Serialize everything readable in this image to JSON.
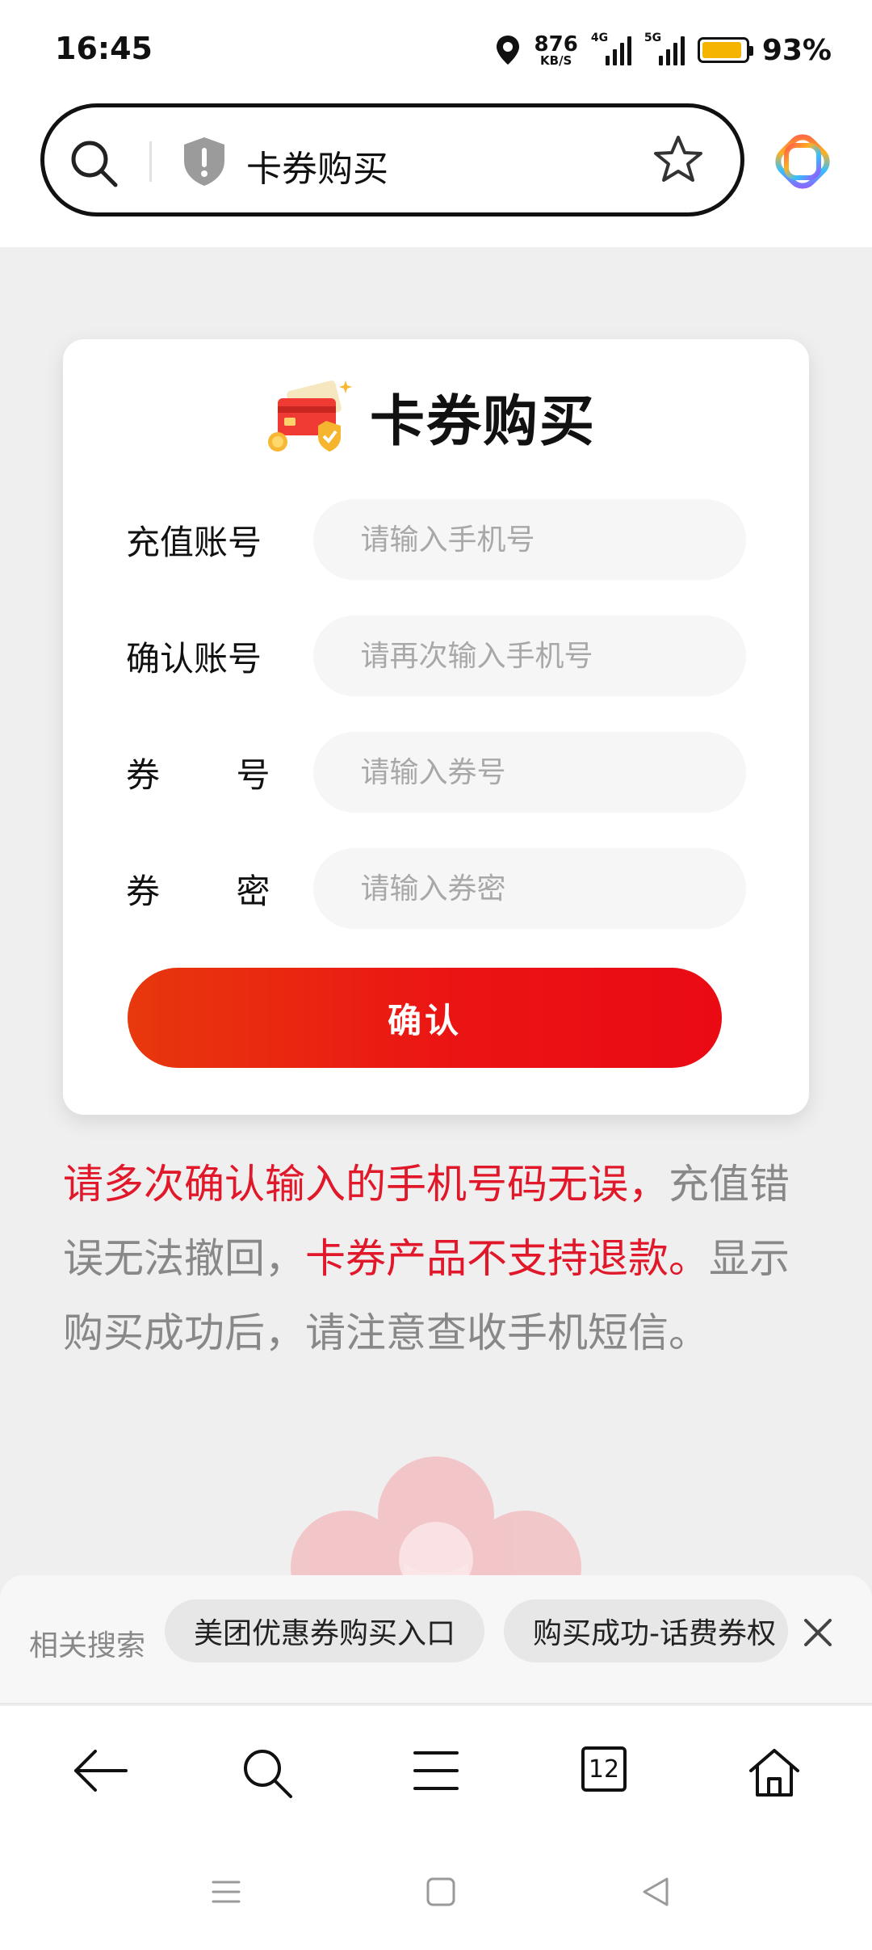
{
  "status_bar": {
    "time": "16:45",
    "net_speed": "876",
    "net_unit": "KB/S",
    "signal1_type": "4G",
    "signal2_type": "5G",
    "battery_percent": "93%",
    "battery_level": 0.93,
    "battery_color": "#f4b400"
  },
  "address_bar": {
    "text": "卡券购买",
    "icons": [
      "search-icon",
      "shield-alert-icon",
      "star-icon",
      "app-logo"
    ]
  },
  "card": {
    "title": "卡券购买",
    "icon": "coupon-cards-icon",
    "fields": [
      {
        "label": "充值账号",
        "placeholder": "请输入手机号"
      },
      {
        "label_chars": [
          "确",
          "认",
          "账",
          "号"
        ],
        "label": "确认账号",
        "placeholder": "请再次输入手机号"
      },
      {
        "label_chars": [
          "券",
          "号"
        ],
        "label": "券号",
        "placeholder": "请输入券号"
      },
      {
        "label_chars": [
          "券",
          "密"
        ],
        "label": "券密",
        "placeholder": "请输入券密"
      }
    ],
    "confirm_label": "确认",
    "accent_color": "#eb1414"
  },
  "notice": {
    "part1_red": "请多次确认输入的手机号码无误，",
    "part2": "充值错误无法撤回，",
    "part3_red": "卡券产品不支持退款。",
    "part4": "显示购买成功后，请注意查收手机短信。",
    "red_color": "#e1172a"
  },
  "related": {
    "label": "相关搜索",
    "chips": [
      "美团优惠券购买入口",
      "购买成功-话费券权"
    ],
    "close_icon": "close-icon"
  },
  "bottom_nav": {
    "tab_count": "12",
    "icons": [
      "back-arrow-icon",
      "search-icon",
      "menu-icon",
      "tabs-icon",
      "home-icon"
    ]
  },
  "system_nav": {
    "icons": [
      "recents-icon",
      "home-square-icon",
      "back-triangle-icon"
    ]
  }
}
